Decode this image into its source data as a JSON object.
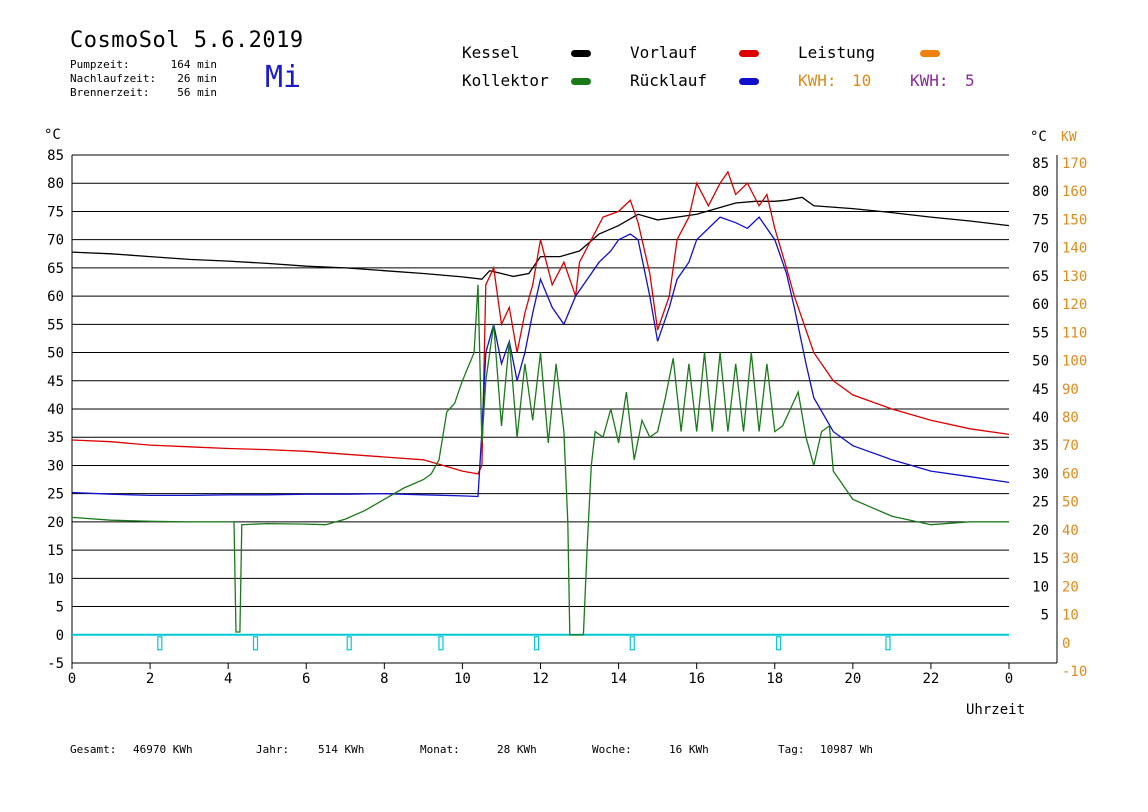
{
  "header": {
    "title": "CosmoSol 5.6.2019",
    "weekday": "Mi",
    "stats": [
      {
        "label": "Pumpzeit:",
        "value": "164 min"
      },
      {
        "label": "Nachlaufzeit:",
        "value": "26 min"
      },
      {
        "label": "Brennerzeit:",
        "value": "56 min"
      }
    ]
  },
  "legend": {
    "kessel": {
      "label": "Kessel",
      "color": "#000000"
    },
    "vorlauf": {
      "label": "Vorlauf",
      "color": "#dd0000"
    },
    "leistung": {
      "label": "Leistung",
      "color": "#f08010"
    },
    "kollektor": {
      "label": "Kollektor",
      "color": "#1a7a1a"
    },
    "ruecklauf": {
      "label": "Rücklauf",
      "color": "#1010cc"
    },
    "kwh_orange": {
      "label": "KWH:",
      "value": "10",
      "color": "#e08a1a"
    },
    "kwh_purple": {
      "label": "KWH:",
      "value": "5",
      "color": "#8a2a9a"
    }
  },
  "footer": {
    "gesamt_label": "Gesamt:",
    "gesamt_value": "46970 KWh",
    "jahr_label": "Jahr:",
    "jahr_value": "514 KWh",
    "monat_label": "Monat:",
    "monat_value": "28 KWh",
    "woche_label": "Woche:",
    "woche_value": "16 KWh",
    "tag_label": "Tag:",
    "tag_value": "10987 Wh"
  },
  "chart_data": {
    "type": "line",
    "xlabel": "Uhrzeit",
    "ylabel_left": "°C",
    "ylabel_right": "°C",
    "ylabel_right2": "KW",
    "xlim": [
      0,
      24
    ],
    "ylim": [
      -5,
      85
    ],
    "ylim_kw": [
      -10,
      170
    ],
    "x_ticks": [
      "0",
      "2",
      "4",
      "6",
      "8",
      "10",
      "12",
      "14",
      "16",
      "18",
      "20",
      "22",
      "0"
    ],
    "y_ticks_left": [
      "85",
      "80",
      "75",
      "70",
      "65",
      "60",
      "55",
      "50",
      "45",
      "40",
      "35",
      "30",
      "25",
      "20",
      "15",
      "10",
      "5",
      "0",
      "-5"
    ],
    "y_ticks_right": [
      "85",
      "80",
      "75",
      "70",
      "65",
      "60",
      "55",
      "50",
      "45",
      "40",
      "35",
      "30",
      "25",
      "20",
      "15",
      "10",
      "5"
    ],
    "y_ticks_kw": [
      "170",
      "160",
      "150",
      "140",
      "130",
      "120",
      "110",
      "100",
      "90",
      "80",
      "70",
      "60",
      "50",
      "40",
      "30",
      "20",
      "10",
      "0",
      "-10"
    ],
    "grid": true,
    "series": [
      {
        "name": "Kessel",
        "color": "#000000",
        "points": [
          [
            0,
            67.8
          ],
          [
            1,
            67.5
          ],
          [
            2,
            67
          ],
          [
            3,
            66.5
          ],
          [
            4,
            66.2
          ],
          [
            5,
            65.8
          ],
          [
            6,
            65.3
          ],
          [
            7,
            65
          ],
          [
            8,
            64.5
          ],
          [
            9,
            64
          ],
          [
            10,
            63.4
          ],
          [
            10.5,
            63
          ],
          [
            10.7,
            64.5
          ],
          [
            11,
            64
          ],
          [
            11.3,
            63.5
          ],
          [
            11.7,
            64
          ],
          [
            12,
            67
          ],
          [
            12.5,
            67
          ],
          [
            13,
            68
          ],
          [
            13.5,
            71
          ],
          [
            14,
            72.5
          ],
          [
            14.5,
            74.5
          ],
          [
            15,
            73.5
          ],
          [
            15.5,
            74
          ],
          [
            16,
            74.5
          ],
          [
            16.5,
            75.5
          ],
          [
            17,
            76.5
          ],
          [
            17.5,
            76.8
          ],
          [
            18,
            76.8
          ],
          [
            18.3,
            77
          ],
          [
            18.7,
            77.5
          ],
          [
            19,
            76
          ],
          [
            20,
            75.5
          ],
          [
            21,
            74.8
          ],
          [
            22,
            74
          ],
          [
            23,
            73.3
          ],
          [
            24,
            72.5
          ]
        ]
      },
      {
        "name": "Vorlauf",
        "color": "#dd0000",
        "points": [
          [
            0,
            34.5
          ],
          [
            1,
            34.2
          ],
          [
            2,
            33.6
          ],
          [
            3,
            33.3
          ],
          [
            4,
            33
          ],
          [
            5,
            32.8
          ],
          [
            6,
            32.5
          ],
          [
            7,
            32
          ],
          [
            8,
            31.5
          ],
          [
            9,
            31
          ],
          [
            9.5,
            30
          ],
          [
            10,
            29
          ],
          [
            10.4,
            28.5
          ],
          [
            10.5,
            30
          ],
          [
            10.6,
            62
          ],
          [
            10.8,
            65
          ],
          [
            11,
            55
          ],
          [
            11.2,
            58
          ],
          [
            11.4,
            50
          ],
          [
            11.6,
            57
          ],
          [
            11.8,
            62
          ],
          [
            12,
            70
          ],
          [
            12.3,
            62
          ],
          [
            12.6,
            66
          ],
          [
            12.9,
            60
          ],
          [
            13,
            66
          ],
          [
            13.3,
            70
          ],
          [
            13.6,
            74
          ],
          [
            14,
            75
          ],
          [
            14.3,
            77
          ],
          [
            14.5,
            73
          ],
          [
            14.8,
            64
          ],
          [
            15,
            54
          ],
          [
            15.3,
            60
          ],
          [
            15.5,
            70
          ],
          [
            15.8,
            74
          ],
          [
            16,
            80
          ],
          [
            16.3,
            76
          ],
          [
            16.6,
            80
          ],
          [
            16.8,
            82
          ],
          [
            17,
            78
          ],
          [
            17.3,
            80
          ],
          [
            17.6,
            76
          ],
          [
            17.8,
            78
          ],
          [
            18,
            72
          ],
          [
            18.3,
            65
          ],
          [
            18.5,
            60
          ],
          [
            18.8,
            54
          ],
          [
            19,
            50
          ],
          [
            19.5,
            45
          ],
          [
            20,
            42.5
          ],
          [
            21,
            40
          ],
          [
            22,
            38
          ],
          [
            23,
            36.5
          ],
          [
            24,
            35.5
          ]
        ]
      },
      {
        "name": "Rücklauf",
        "color": "#1010cc",
        "points": [
          [
            0,
            25.2
          ],
          [
            1,
            24.9
          ],
          [
            2,
            24.7
          ],
          [
            3,
            24.7
          ],
          [
            4,
            24.8
          ],
          [
            5,
            24.8
          ],
          [
            6,
            24.9
          ],
          [
            7,
            24.9
          ],
          [
            8,
            25
          ],
          [
            9,
            24.8
          ],
          [
            10,
            24.6
          ],
          [
            10.4,
            24.5
          ],
          [
            10.5,
            36
          ],
          [
            10.6,
            50
          ],
          [
            10.8,
            55
          ],
          [
            11,
            48
          ],
          [
            11.2,
            52
          ],
          [
            11.4,
            45
          ],
          [
            11.6,
            50
          ],
          [
            11.8,
            57
          ],
          [
            12,
            63
          ],
          [
            12.3,
            58
          ],
          [
            12.6,
            55
          ],
          [
            12.9,
            60
          ],
          [
            13.2,
            63
          ],
          [
            13.5,
            66
          ],
          [
            13.8,
            68
          ],
          [
            14,
            70
          ],
          [
            14.3,
            71
          ],
          [
            14.5,
            70
          ],
          [
            14.8,
            60
          ],
          [
            15,
            52
          ],
          [
            15.3,
            58
          ],
          [
            15.5,
            63
          ],
          [
            15.8,
            66
          ],
          [
            16,
            70
          ],
          [
            16.3,
            72
          ],
          [
            16.6,
            74
          ],
          [
            17,
            73
          ],
          [
            17.3,
            72
          ],
          [
            17.6,
            74
          ],
          [
            17.8,
            72
          ],
          [
            18,
            70
          ],
          [
            18.3,
            64
          ],
          [
            18.5,
            58
          ],
          [
            18.8,
            48
          ],
          [
            19,
            42
          ],
          [
            19.5,
            36
          ],
          [
            20,
            33.5
          ],
          [
            21,
            31
          ],
          [
            22,
            29
          ],
          [
            23,
            28
          ],
          [
            24,
            27
          ]
        ]
      },
      {
        "name": "Kollektor",
        "color": "#1a7a1a",
        "points": [
          [
            0,
            20.8
          ],
          [
            1,
            20.3
          ],
          [
            2,
            20.1
          ],
          [
            3,
            20
          ],
          [
            4,
            20
          ],
          [
            4.15,
            20
          ],
          [
            4.2,
            0.5
          ],
          [
            4.3,
            0.5
          ],
          [
            4.35,
            19.5
          ],
          [
            5,
            19.7
          ],
          [
            6,
            19.6
          ],
          [
            6.5,
            19.5
          ],
          [
            7,
            20.5
          ],
          [
            7.5,
            22
          ],
          [
            8,
            24
          ],
          [
            8.5,
            26
          ],
          [
            9,
            27.5
          ],
          [
            9.2,
            28.5
          ],
          [
            9.4,
            31
          ],
          [
            9.6,
            39.5
          ],
          [
            9.8,
            41
          ],
          [
            10,
            45
          ],
          [
            10.3,
            50
          ],
          [
            10.4,
            62
          ],
          [
            10.5,
            34
          ],
          [
            10.6,
            45
          ],
          [
            10.8,
            55
          ],
          [
            11,
            37
          ],
          [
            11.2,
            52
          ],
          [
            11.4,
            35
          ],
          [
            11.6,
            48
          ],
          [
            11.8,
            38
          ],
          [
            12,
            50
          ],
          [
            12.2,
            34
          ],
          [
            12.4,
            48
          ],
          [
            12.6,
            36
          ],
          [
            12.7,
            20
          ],
          [
            12.75,
            0
          ],
          [
            13.1,
            0
          ],
          [
            13.2,
            16
          ],
          [
            13.3,
            30
          ],
          [
            13.4,
            36
          ],
          [
            13.6,
            35
          ],
          [
            13.8,
            40
          ],
          [
            14,
            34
          ],
          [
            14.2,
            43
          ],
          [
            14.4,
            31
          ],
          [
            14.6,
            38
          ],
          [
            14.8,
            35
          ],
          [
            15,
            36
          ],
          [
            15.2,
            42
          ],
          [
            15.4,
            49
          ],
          [
            15.6,
            36
          ],
          [
            15.8,
            48
          ],
          [
            16,
            36
          ],
          [
            16.2,
            50
          ],
          [
            16.4,
            36
          ],
          [
            16.6,
            50
          ],
          [
            16.8,
            36
          ],
          [
            17,
            48
          ],
          [
            17.2,
            36
          ],
          [
            17.4,
            50
          ],
          [
            17.6,
            36
          ],
          [
            17.8,
            48
          ],
          [
            18,
            36
          ],
          [
            18.2,
            37
          ],
          [
            18.4,
            40
          ],
          [
            18.6,
            43
          ],
          [
            18.8,
            35
          ],
          [
            19,
            30
          ],
          [
            19.2,
            36
          ],
          [
            19.4,
            37
          ],
          [
            19.5,
            29
          ],
          [
            19.7,
            27
          ],
          [
            20,
            24
          ],
          [
            20.5,
            22.5
          ],
          [
            21,
            21
          ],
          [
            22,
            19.5
          ],
          [
            23,
            20
          ],
          [
            24,
            20
          ]
        ]
      }
    ],
    "markers": {
      "color": "#00c8d8",
      "x": [
        2.25,
        4.7,
        7.1,
        9.45,
        11.9,
        14.35,
        18.1,
        20.9
      ]
    }
  }
}
